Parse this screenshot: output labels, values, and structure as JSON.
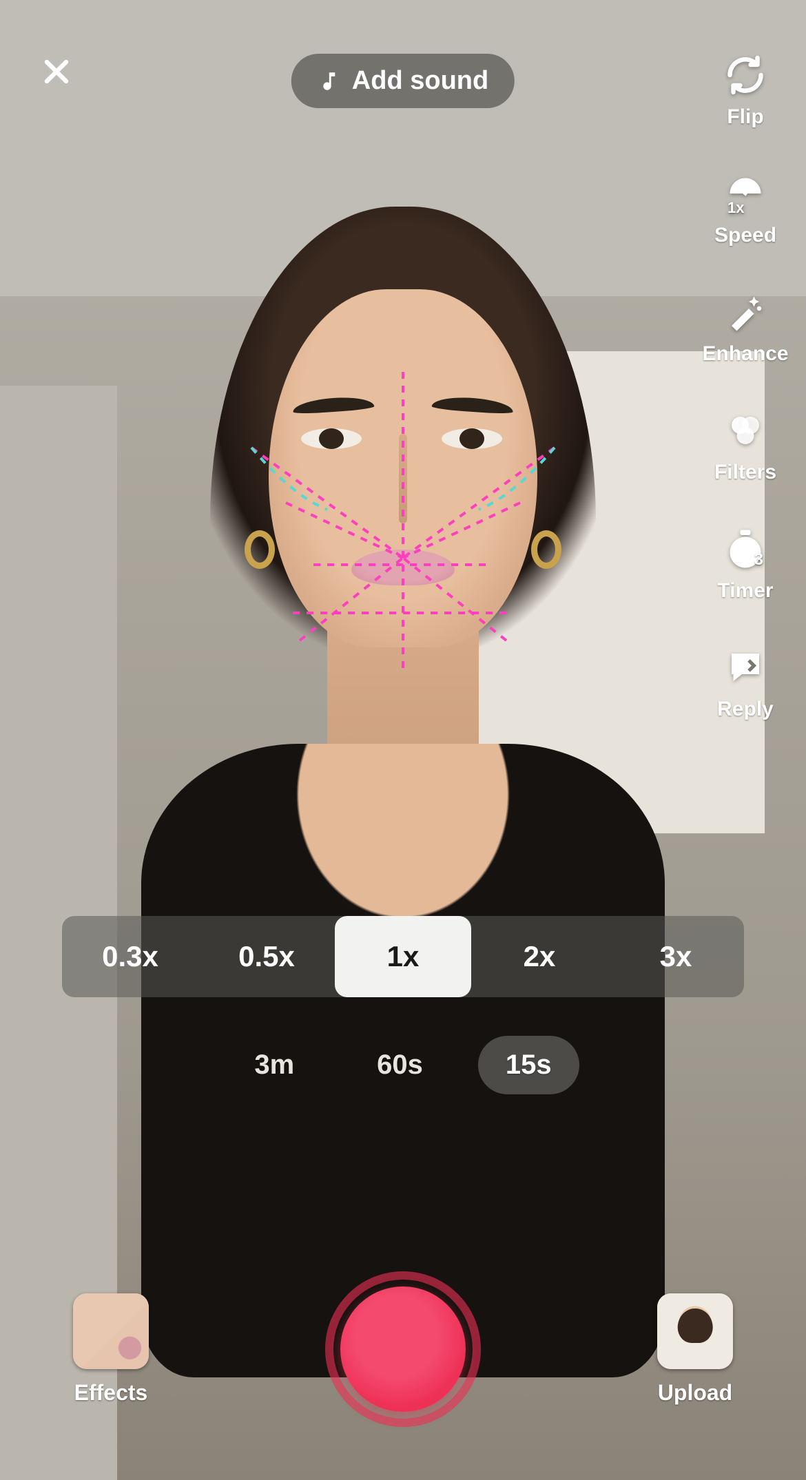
{
  "header": {
    "add_sound_label": "Add sound"
  },
  "side_tools": {
    "flip": {
      "label": "Flip"
    },
    "speed": {
      "label": "Speed",
      "badge": "1x"
    },
    "enhance": {
      "label": "Enhance"
    },
    "filters": {
      "label": "Filters"
    },
    "timer": {
      "label": "Timer",
      "badge": "3"
    },
    "reply": {
      "label": "Reply"
    }
  },
  "zoom": {
    "options": [
      "0.3x",
      "0.5x",
      "1x",
      "2x",
      "3x"
    ],
    "selected": "1x"
  },
  "duration": {
    "options": [
      "3m",
      "60s",
      "15s"
    ],
    "selected": "15s"
  },
  "bottom": {
    "effects_label": "Effects",
    "upload_label": "Upload"
  },
  "filter_overlay": {
    "line_color": "#ff3fbf",
    "accent_color": "#58d7d3"
  }
}
